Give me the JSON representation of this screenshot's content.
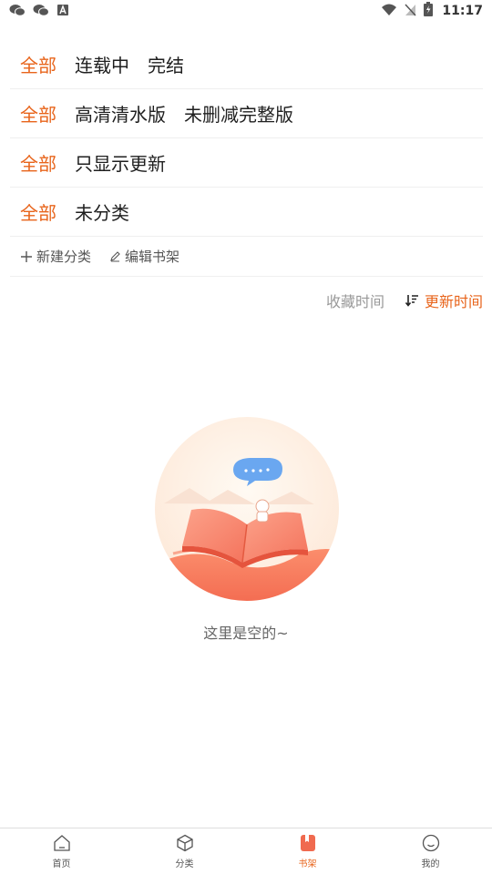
{
  "status_bar": {
    "time": "11:17",
    "left_icons": [
      "wechat-icon",
      "wechat-icon",
      "app-notification-icon"
    ],
    "right_icons": [
      "wifi-icon",
      "no-sim-icon",
      "battery-charging-icon"
    ]
  },
  "filters": [
    {
      "all": "全部",
      "options": [
        "连载中",
        "完结"
      ]
    },
    {
      "all": "全部",
      "options": [
        "高清清水版",
        "未删减完整版"
      ]
    },
    {
      "all": "全部",
      "options": [
        "只显示更新"
      ]
    },
    {
      "all": "全部",
      "options": [
        "未分类"
      ]
    }
  ],
  "actions": {
    "new_category": "新建分类",
    "edit_shelf": "编辑书架"
  },
  "sort": {
    "collected_time": "收藏时间",
    "updated_time": "更新时间"
  },
  "empty_state": {
    "message": "这里是空的~"
  },
  "bottom_nav": [
    {
      "label": "首页",
      "icon": "home-icon"
    },
    {
      "label": "分类",
      "icon": "category-icon"
    },
    {
      "label": "书架",
      "icon": "bookshelf-icon"
    },
    {
      "label": "我的",
      "icon": "profile-icon"
    }
  ],
  "colors": {
    "accent": "#e8641b",
    "divider": "#efefef",
    "text": "#1f1f1f"
  }
}
